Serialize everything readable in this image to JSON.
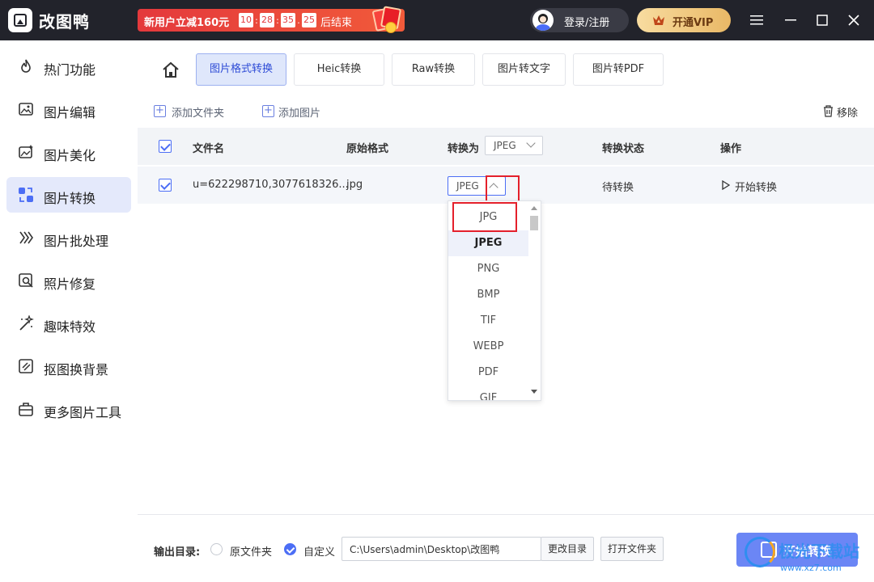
{
  "app": {
    "title": "改图鸭"
  },
  "promo": {
    "text": "新用户立减160元",
    "timer": [
      "10",
      "28",
      "35",
      "25"
    ],
    "end_text": "后结束"
  },
  "header": {
    "login_label": "登录/注册",
    "vip_label": "开通VIP"
  },
  "sidebar": {
    "items": [
      {
        "label": "热门功能",
        "icon": "flame-icon",
        "active": false
      },
      {
        "label": "图片编辑",
        "icon": "image-edit-icon",
        "active": false
      },
      {
        "label": "图片美化",
        "icon": "image-beautify-icon",
        "active": false
      },
      {
        "label": "图片转换",
        "icon": "image-convert-icon",
        "active": true
      },
      {
        "label": "图片批处理",
        "icon": "batch-icon",
        "active": false
      },
      {
        "label": "照片修复",
        "icon": "photo-repair-icon",
        "active": false
      },
      {
        "label": "趣味特效",
        "icon": "magic-wand-icon",
        "active": false
      },
      {
        "label": "抠图换背景",
        "icon": "cutout-icon",
        "active": false
      },
      {
        "label": "更多图片工具",
        "icon": "toolbox-icon",
        "active": false
      }
    ]
  },
  "tabs": [
    {
      "label": "图片格式转换",
      "active": true
    },
    {
      "label": "Heic转换",
      "active": false
    },
    {
      "label": "Raw转换",
      "active": false
    },
    {
      "label": "图片转文字",
      "active": false
    },
    {
      "label": "图片转PDF",
      "active": false
    }
  ],
  "toolbar": {
    "add_folder": "添加文件夹",
    "add_image": "添加图片",
    "remove": "移除"
  },
  "table": {
    "headers": {
      "filename": "文件名",
      "orig_format": "原始格式",
      "convert_to": "转换为",
      "convert_to_value": "JPEG",
      "status": "转换状态",
      "action": "操作"
    },
    "rows": [
      {
        "filename": "u=622298710,3077618326...",
        "orig_format": "jpg",
        "convert_to": "JPEG",
        "status": "待转换",
        "action": "开始转换"
      }
    ]
  },
  "dropdown": {
    "options": [
      "JPG",
      "JPEG",
      "PNG",
      "BMP",
      "TIF",
      "WEBP",
      "PDF",
      "GIF"
    ],
    "selected": "JPEG"
  },
  "footer": {
    "output_label": "输出目录:",
    "radio_original": "原文件夹",
    "radio_custom": "自定义",
    "path_value": "C:\\Users\\admin\\Desktop\\改图鸭",
    "change_dir": "更改目录",
    "open_folder": "打开文件夹",
    "start_all": "开始转换"
  },
  "watermark": {
    "text": "极光下载站",
    "url": "www.xz7.com"
  },
  "colors": {
    "accent": "#4c6ef5",
    "titlebar": "#22232b",
    "promo": "#e4393c",
    "highlight": "#e4202b"
  }
}
